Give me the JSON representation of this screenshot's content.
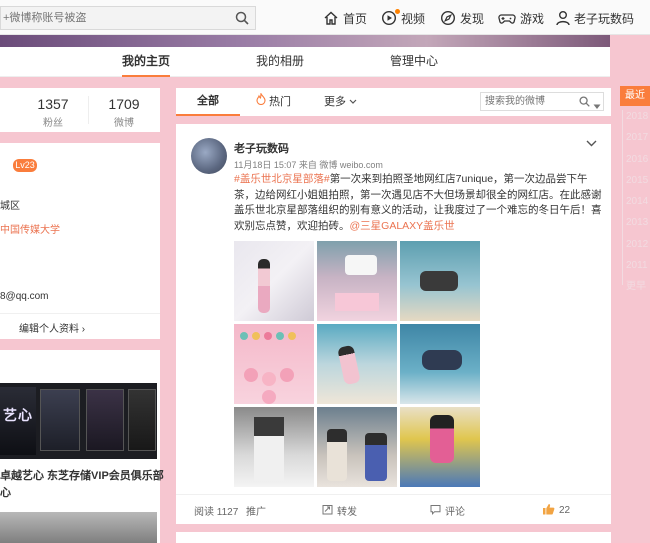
{
  "topbar": {
    "search_placeholder": "+微博称账号被盗",
    "nav": [
      {
        "label": "首页",
        "icon": "home-icon"
      },
      {
        "label": "视频",
        "icon": "video-icon"
      },
      {
        "label": "发现",
        "icon": "discover-icon"
      },
      {
        "label": "游戏",
        "icon": "game-icon"
      },
      {
        "label": "老子玩数码",
        "icon": "user-icon"
      }
    ]
  },
  "profile_tabs": [
    "我的主页",
    "我的相册",
    "管理中心"
  ],
  "stats": [
    {
      "num": "1357",
      "label": "粉丝"
    },
    {
      "num": "1709",
      "label": "微博"
    }
  ],
  "info": {
    "level": "Lv23",
    "location": "城区",
    "school": "中国传媒大学",
    "email": "8@qq.com",
    "edit_label": "编辑个人资料"
  },
  "promo": {
    "caption_line1": "卓越艺心 东芝存储VIP会员俱乐部",
    "caption_line2": "心",
    "banner_text": "艺心"
  },
  "feed": {
    "tabs": [
      "全部",
      "热门",
      "更多"
    ],
    "search_placeholder": "搜索我的微博"
  },
  "post": {
    "author": "老子玩数码",
    "meta": "11月18日 15:07 来自 微博 weibo.com",
    "hashtag": "#盖乐世北京星部落#",
    "text": "第一次来到拍照圣地网红店7unique，第一次边品尝下午茶，边给网红小姐姐拍照，第一次遇见店不大但场景却很全的网红店。在此感谢盖乐世北京星部落组织的别有意义的活动，让我度过了一个难忘的冬日午后！喜欢别忘点赞，欢迎拍砖。",
    "mention": "@三星GALAXY盖乐世",
    "actions": {
      "reads": "阅读 1127",
      "promote": "推广",
      "repost": "转发",
      "comment": "评论",
      "likes": "22"
    }
  },
  "years": {
    "active": "最近",
    "list": [
      "2018",
      "2017",
      "2016",
      "2015",
      "2014",
      "2013",
      "2012",
      "2011",
      "更早"
    ]
  },
  "colors": {
    "accent": "#fa7d3c",
    "link": "#eb7350",
    "background": "#f6c6d0"
  }
}
